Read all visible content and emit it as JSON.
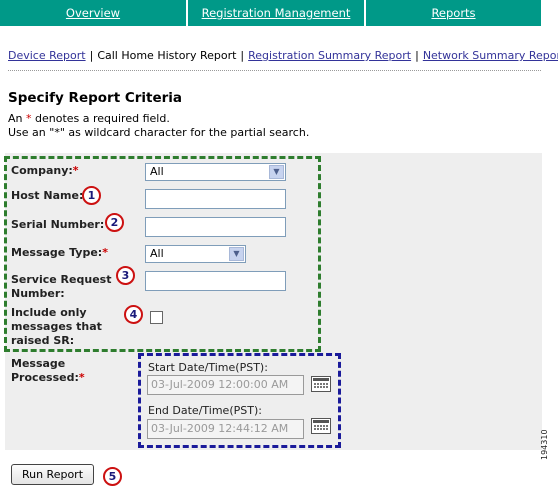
{
  "tabs": [
    {
      "label": "Overview"
    },
    {
      "label": "Registration Management"
    },
    {
      "label": "Reports"
    }
  ],
  "report_links": {
    "device": "Device Report",
    "call_home_history": "Call Home History Report",
    "registration_summary": "Registration Summary Report",
    "network_summary": "Network Summary Report",
    "separator": "|"
  },
  "page": {
    "title": "Specify Report Criteria",
    "required_note_prefix": "An ",
    "required_note_star": "*",
    "required_note_suffix": " denotes a required field.",
    "wildcard_note": "Use an \"*\" as wildcard character for the partial search."
  },
  "form": {
    "company": {
      "label": "Company:",
      "required": "*",
      "value": "All"
    },
    "host_name": {
      "label": "Host Name:",
      "value": "",
      "callout": "1"
    },
    "serial_number": {
      "label": "Serial Number:",
      "value": "",
      "callout": "2"
    },
    "message_type": {
      "label": "Message Type:",
      "required": "*",
      "value": "All"
    },
    "service_request": {
      "label_line1": "Service Request",
      "label_line2": "Number:",
      "value": "",
      "callout": "3"
    },
    "include_only": {
      "label_line1": "Include only",
      "label_line2": "messages that",
      "label_line3": "raised SR:",
      "checked": false,
      "callout": "4"
    },
    "message_processed": {
      "label_line1": "Message",
      "label_line2": "Processed:",
      "required": "*",
      "start_label": "Start Date/Time(PST):",
      "start_value": "03-Jul-2009 12:00:00 AM",
      "end_label": "End Date/Time(PST):",
      "end_value": "03-Jul-2009 12:44:12 AM"
    },
    "run_button": {
      "label": "Run Report",
      "callout": "5"
    }
  },
  "figure_id": "194310",
  "colors": {
    "tab_bg": "#009988",
    "link": "#333399",
    "required": "#cc0000",
    "green_outline": "#2e7d2e",
    "blue_outline": "#1a1a9a",
    "callout_ring": "#cc1111"
  }
}
